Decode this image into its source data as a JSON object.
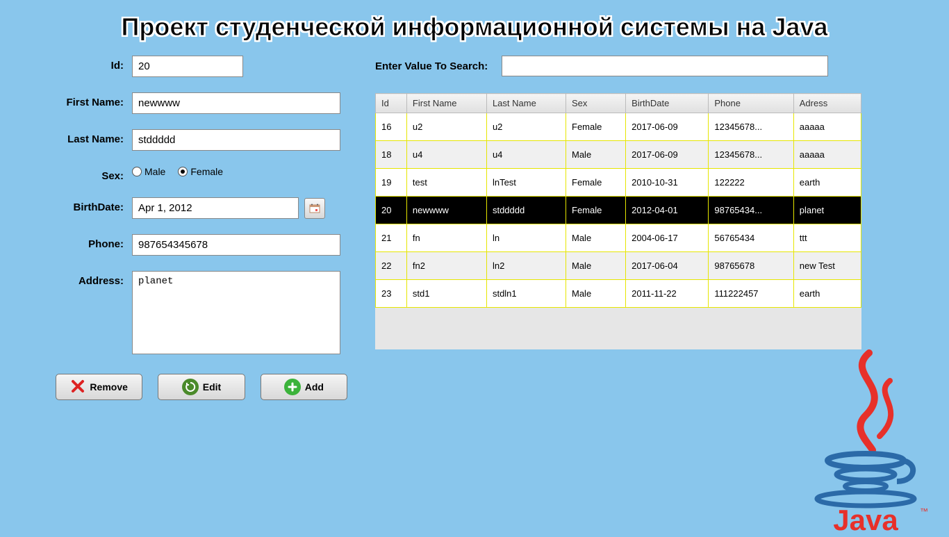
{
  "title": "Проект студенческой информационной системы на Java",
  "form": {
    "id": {
      "label": "Id:",
      "value": "20"
    },
    "firstName": {
      "label": "First Name:",
      "value": "newwww"
    },
    "lastName": {
      "label": "Last Name:",
      "value": "stddddd"
    },
    "sex": {
      "label": "Sex:",
      "male": "Male",
      "female": "Female",
      "selected": "female"
    },
    "birthDate": {
      "label": "BirthDate:",
      "value": "Apr 1, 2012"
    },
    "phone": {
      "label": "Phone:",
      "value": "987654345678"
    },
    "address": {
      "label": "Address:",
      "value": "planet"
    }
  },
  "buttons": {
    "remove": "Remove",
    "edit": "Edit",
    "add": "Add"
  },
  "search": {
    "label": "Enter Value To Search:",
    "value": ""
  },
  "table": {
    "headers": [
      "Id",
      "First Name",
      "Last Name",
      "Sex",
      "BirthDate",
      "Phone",
      "Adress"
    ],
    "rows": [
      {
        "cells": [
          "16",
          "u2",
          "u2",
          "Female",
          "2017-06-09",
          "12345678...",
          "aaaaa"
        ],
        "alt": false
      },
      {
        "cells": [
          "18",
          "u4",
          "u4",
          "Male",
          "2017-06-09",
          "12345678...",
          "aaaaa"
        ],
        "alt": true
      },
      {
        "cells": [
          "19",
          "test",
          "lnTest",
          "Female",
          "2010-10-31",
          "122222",
          "earth"
        ],
        "alt": false
      },
      {
        "cells": [
          "20",
          "newwww",
          "stddddd",
          "Female",
          "2012-04-01",
          "98765434...",
          "planet"
        ],
        "selected": true
      },
      {
        "cells": [
          "21",
          "fn",
          "ln",
          "Male",
          "2004-06-17",
          "56765434",
          "ttt"
        ],
        "alt": false
      },
      {
        "cells": [
          "22",
          "fn2",
          "ln2",
          "Male",
          "2017-06-04",
          "98765678",
          "new Test"
        ],
        "alt": true
      },
      {
        "cells": [
          "23",
          "std1",
          "stdln1",
          "Male",
          "2011-11-22",
          "111222457",
          "earth"
        ],
        "alt": false
      }
    ]
  },
  "logo_text": "Java"
}
